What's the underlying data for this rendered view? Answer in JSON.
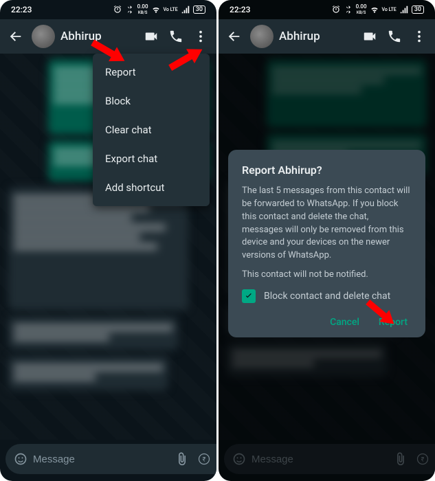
{
  "status": {
    "time": "22:23",
    "kbps": "0.00",
    "kbps_unit": "KB/S",
    "net": "Vo LTE",
    "battery": "30"
  },
  "header": {
    "contact": "Abhirup"
  },
  "input": {
    "placeholder": "Message"
  },
  "menu": {
    "items": [
      "Report",
      "Block",
      "Clear chat",
      "Export chat",
      "Add shortcut"
    ]
  },
  "dialog": {
    "title": "Report Abhirup?",
    "body": "The last 5 messages from this contact will be forwarded to WhatsApp. If you block this contact and delete the chat, messages will only be removed from this device and your devices on the newer versions of WhatsApp.",
    "note": "This contact will not be notified.",
    "checkbox_label": "Block contact and delete chat",
    "cancel": "Cancel",
    "confirm": "Report"
  }
}
